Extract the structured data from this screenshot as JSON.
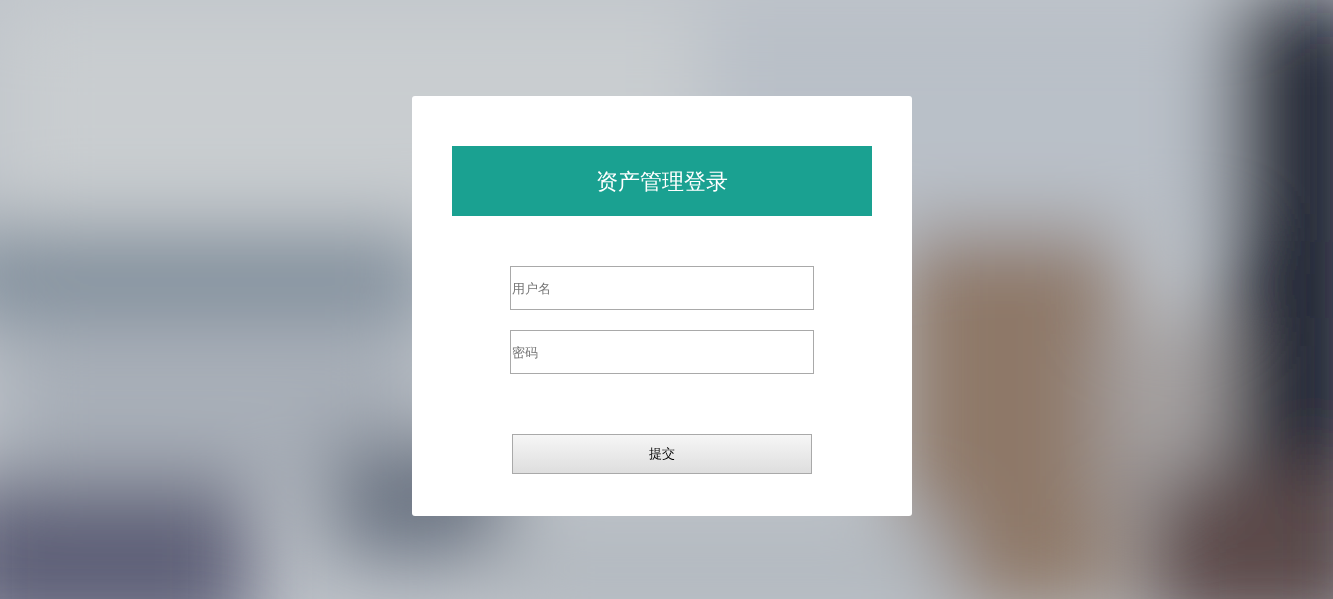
{
  "login": {
    "title": "资产管理登录",
    "fields": [
      {
        "placeholder": "用户名"
      },
      {
        "placeholder": "密码"
      }
    ],
    "submit": "提交"
  }
}
